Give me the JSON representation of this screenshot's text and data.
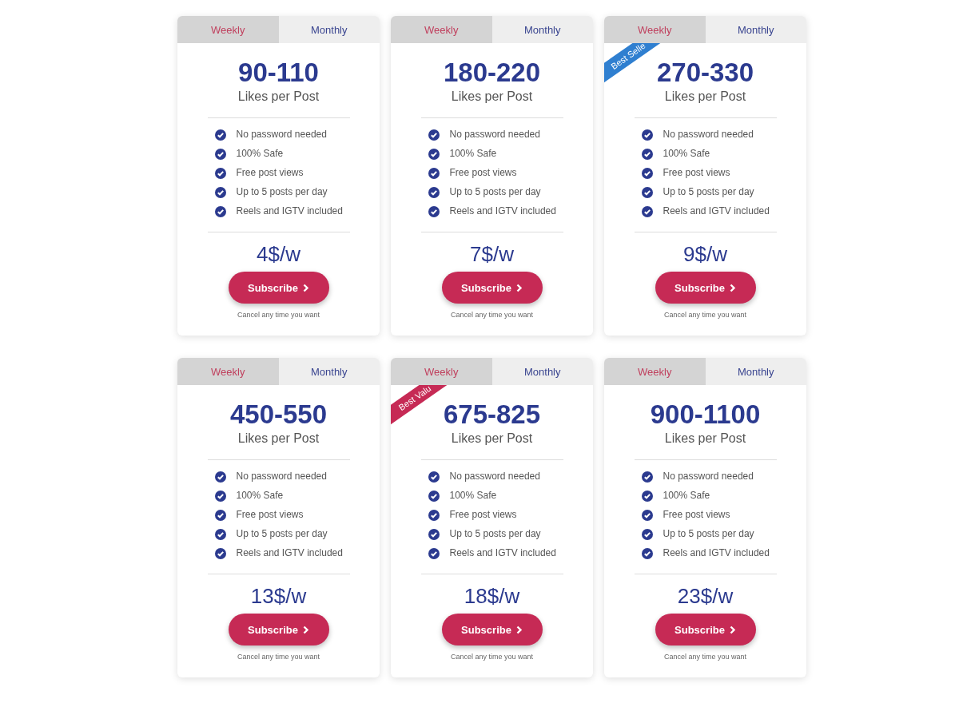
{
  "plans": [
    {
      "tabs": [
        {
          "label": "Weekly",
          "selected": true
        },
        {
          "label": "Monthly",
          "selected": false
        }
      ],
      "amount": "90-110",
      "unit": "Likes per Post",
      "features": [
        "No password needed",
        "100% Safe",
        "Free post views",
        "Up to 5 posts per day",
        "Reels and IGTV included"
      ],
      "price": "4$/w",
      "button": "Subscribe",
      "note": "Cancel any time you want"
    },
    {
      "tabs": [
        {
          "label": "Weekly",
          "selected": true
        },
        {
          "label": "Monthly",
          "selected": false
        }
      ],
      "amount": "180-220",
      "unit": "Likes per Post",
      "features": [
        "No password needed",
        "100% Safe",
        "Free post views",
        "Up to 5 posts per day",
        "Reels and IGTV included"
      ],
      "price": "7$/w",
      "button": "Subscribe",
      "note": "Cancel any time you want"
    },
    {
      "tabs": [
        {
          "label": "Weekly",
          "selected": true
        },
        {
          "label": "Monthly",
          "selected": false
        }
      ],
      "ribbon": {
        "text": "Best Selle",
        "color": "#2f7fd0"
      },
      "amount": "270-330",
      "unit": "Likes per Post",
      "features": [
        "No password needed",
        "100% Safe",
        "Free post views",
        "Up to 5 posts per day",
        "Reels and IGTV included"
      ],
      "price": "9$/w",
      "button": "Subscribe",
      "note": "Cancel any time you want"
    },
    {
      "tabs": [
        {
          "label": "Weekly",
          "selected": true
        },
        {
          "label": "Monthly",
          "selected": false
        }
      ],
      "amount": "450-550",
      "unit": "Likes per Post",
      "features": [
        "No password needed",
        "100% Safe",
        "Free post views",
        "Up to 5 posts per day",
        "Reels and IGTV included"
      ],
      "price": "13$/w",
      "button": "Subscribe",
      "note": "Cancel any time you want"
    },
    {
      "tabs": [
        {
          "label": "Weekly",
          "selected": true
        },
        {
          "label": "Monthly",
          "selected": false
        }
      ],
      "ribbon": {
        "text": "Best Valu",
        "color": "#c62a55"
      },
      "amount": "675-825",
      "unit": "Likes per Post",
      "features": [
        "No password needed",
        "100% Safe",
        "Free post views",
        "Up to 5 posts per day",
        "Reels and IGTV included"
      ],
      "price": "18$/w",
      "button": "Subscribe",
      "note": "Cancel any time you want"
    },
    {
      "tabs": [
        {
          "label": "Weekly",
          "selected": true
        },
        {
          "label": "Monthly",
          "selected": false
        }
      ],
      "amount": "900-1100",
      "unit": "Likes per Post",
      "features": [
        "No password needed",
        "100% Safe",
        "Free post views",
        "Up to 5 posts per day",
        "Reels and IGTV included"
      ],
      "price": "23$/w",
      "button": "Subscribe",
      "note": "Cancel any time you want"
    }
  ]
}
